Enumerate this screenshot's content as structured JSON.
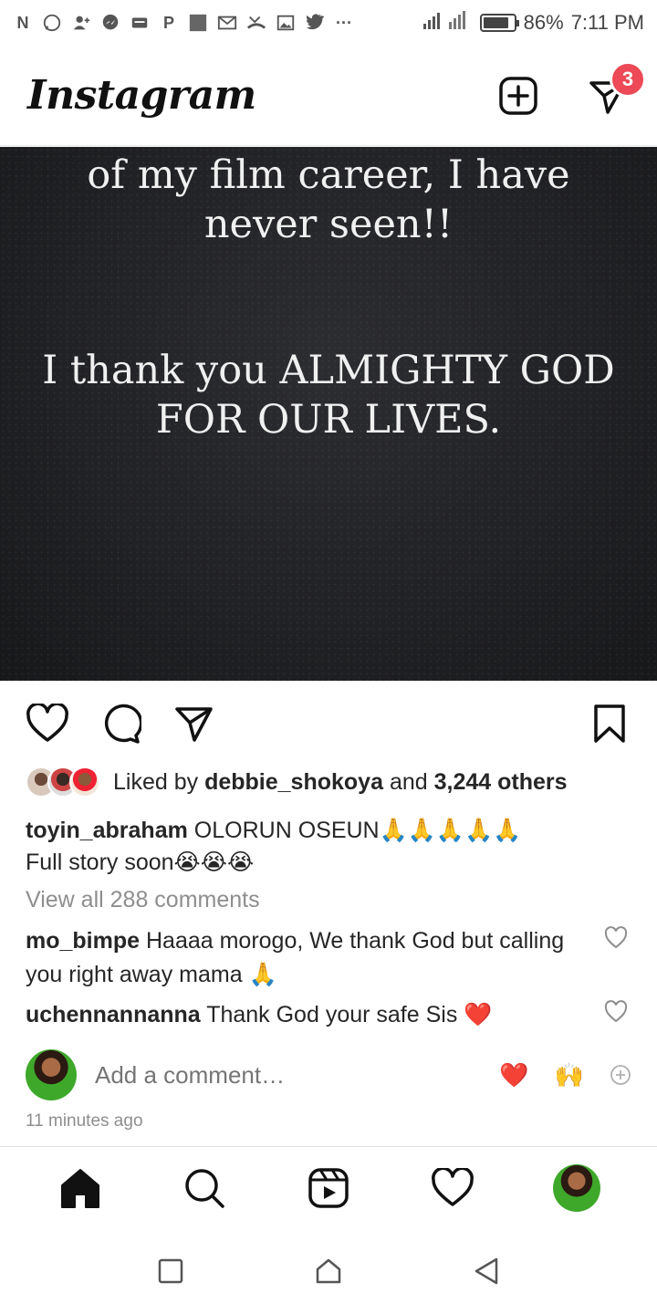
{
  "status_bar": {
    "left_icons": [
      "n-icon",
      "whatsapp-icon",
      "add-user-icon",
      "messenger-icon",
      "message-icon",
      "p-icon",
      "square-icon",
      "gmail-icon",
      "missed-call-icon",
      "image-icon",
      "twitter-icon",
      "more-dots-icon"
    ],
    "battery_percent": "86%",
    "battery_level": 0.86,
    "time": "7:11 PM"
  },
  "header": {
    "logo": "Instagram",
    "new_post_icon": "plus-square-icon",
    "direct_icon": "paper-plane-icon",
    "direct_badge": "3",
    "badge_color": "#ed4956"
  },
  "post": {
    "image_text_top": "of my film career, I have never seen!!",
    "image_text_top_line1": "of my film career, I have",
    "image_text_top_line2": "never seen!!",
    "image_text_bottom_line1": "I thank you ALMIGHTY GOD",
    "image_text_bottom_line2": "FOR OUR LIVES.",
    "actions": {
      "like_icon": "heart-icon",
      "comment_icon": "comment-icon",
      "share_icon": "paper-plane-icon",
      "save_icon": "bookmark-icon"
    },
    "likes": {
      "prefix": "Liked by",
      "user": "debbie_shokoya",
      "connector": "and",
      "others": "3,244 others"
    },
    "caption": {
      "username": "toyin_abraham",
      "text": "OLORUN OSEUN🙏🙏🙏🙏🙏",
      "text_line2": "Full story soon😭😭😭"
    },
    "view_all_comments": "View all 288 comments",
    "comments": [
      {
        "username": "mo_bimpe",
        "text": "Haaaa morogo, We thank God but calling you right away mama 🙏"
      },
      {
        "username": "uchennannanna",
        "text": "Thank God your safe Sis ❤️"
      }
    ],
    "add_comment_placeholder": "Add a comment…",
    "quick_reactions": [
      "❤️",
      "🙌"
    ],
    "timestamp": "11 minutes ago"
  },
  "bottom_nav": {
    "items": [
      "home-icon",
      "search-icon",
      "reels-icon",
      "activity-heart-icon",
      "profile-avatar"
    ]
  },
  "system_nav": {
    "items": [
      "recents-square-icon",
      "home-house-icon",
      "back-triangle-icon"
    ]
  }
}
